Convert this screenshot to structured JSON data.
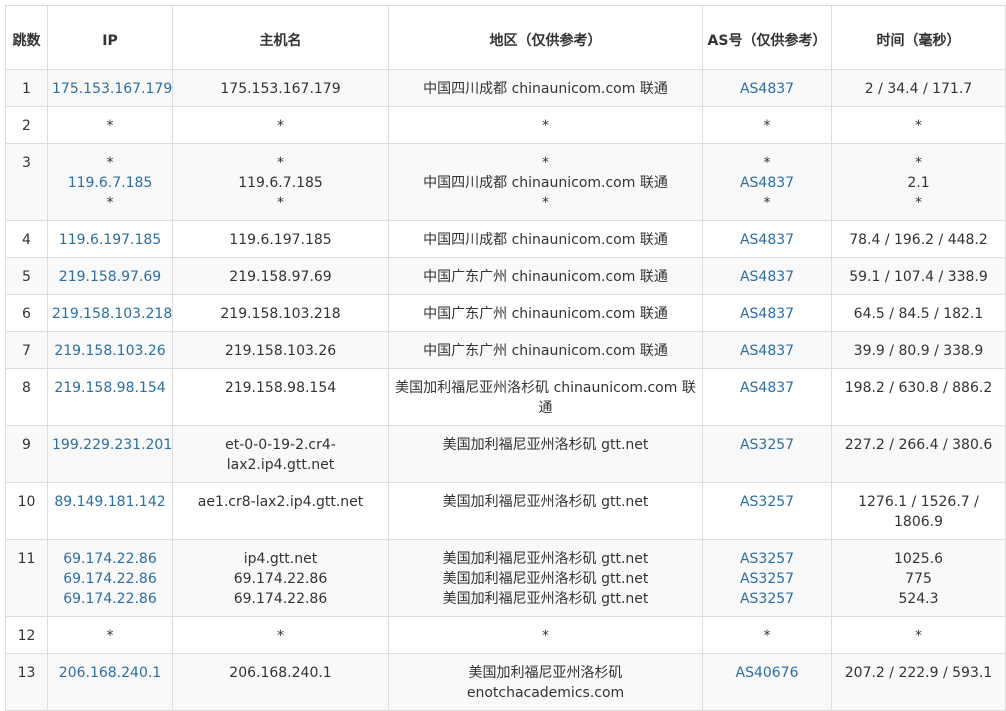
{
  "headers": {
    "hop": "跳数",
    "ip": "IP",
    "hostname": "主机名",
    "region": "地区（仅供参考）",
    "as": "AS号（仅供参考）",
    "time": "时间（毫秒）"
  },
  "rows": [
    {
      "hop": "1",
      "ip": [
        "175.153.167.179"
      ],
      "hostname": [
        "175.153.167.179"
      ],
      "region": [
        "中国四川成都 chinaunicom.com 联通"
      ],
      "as": [
        "AS4837"
      ],
      "time": [
        "2 / 34.4 / 171.7"
      ]
    },
    {
      "hop": "2",
      "ip": [
        "*"
      ],
      "hostname": [
        "*"
      ],
      "region": [
        "*"
      ],
      "as": [
        "*"
      ],
      "time": [
        "*"
      ]
    },
    {
      "hop": "3",
      "ip": [
        "*",
        "119.6.7.185",
        "*"
      ],
      "hostname": [
        "*",
        "119.6.7.185",
        "*"
      ],
      "region": [
        "*",
        "中国四川成都 chinaunicom.com 联通",
        "*"
      ],
      "as": [
        "*",
        "AS4837",
        "*"
      ],
      "time": [
        "*",
        "2.1",
        "*"
      ]
    },
    {
      "hop": "4",
      "ip": [
        "119.6.197.185"
      ],
      "hostname": [
        "119.6.197.185"
      ],
      "region": [
        "中国四川成都 chinaunicom.com 联通"
      ],
      "as": [
        "AS4837"
      ],
      "time": [
        "78.4 / 196.2 / 448.2"
      ]
    },
    {
      "hop": "5",
      "ip": [
        "219.158.97.69"
      ],
      "hostname": [
        "219.158.97.69"
      ],
      "region": [
        "中国广东广州 chinaunicom.com 联通"
      ],
      "as": [
        "AS4837"
      ],
      "time": [
        "59.1 / 107.4 / 338.9"
      ]
    },
    {
      "hop": "6",
      "ip": [
        "219.158.103.218"
      ],
      "hostname": [
        "219.158.103.218"
      ],
      "region": [
        "中国广东广州 chinaunicom.com 联通"
      ],
      "as": [
        "AS4837"
      ],
      "time": [
        "64.5 / 84.5 / 182.1"
      ]
    },
    {
      "hop": "7",
      "ip": [
        "219.158.103.26"
      ],
      "hostname": [
        "219.158.103.26"
      ],
      "region": [
        "中国广东广州 chinaunicom.com 联通"
      ],
      "as": [
        "AS4837"
      ],
      "time": [
        "39.9 / 80.9 / 338.9"
      ]
    },
    {
      "hop": "8",
      "ip": [
        "219.158.98.154"
      ],
      "hostname": [
        "219.158.98.154"
      ],
      "region": [
        "美国加利福尼亚州洛杉矶 chinaunicom.com 联通"
      ],
      "as": [
        "AS4837"
      ],
      "time": [
        "198.2 / 630.8 / 886.2"
      ]
    },
    {
      "hop": "9",
      "ip": [
        "199.229.231.201"
      ],
      "hostname": [
        "et-0-0-19-2.cr4-lax2.ip4.gtt.net"
      ],
      "region": [
        "美国加利福尼亚州洛杉矶 gtt.net"
      ],
      "as": [
        "AS3257"
      ],
      "time": [
        "227.2 / 266.4 / 380.6"
      ]
    },
    {
      "hop": "10",
      "ip": [
        "89.149.181.142"
      ],
      "hostname": [
        "ae1.cr8-lax2.ip4.gtt.net"
      ],
      "region": [
        "美国加利福尼亚州洛杉矶 gtt.net"
      ],
      "as": [
        "AS3257"
      ],
      "time": [
        "1276.1 / 1526.7 / 1806.9"
      ]
    },
    {
      "hop": "11",
      "ip": [
        "69.174.22.86",
        "69.174.22.86",
        "69.174.22.86"
      ],
      "hostname": [
        "ip4.gtt.net",
        "69.174.22.86",
        "69.174.22.86"
      ],
      "region": [
        "美国加利福尼亚州洛杉矶 gtt.net",
        "美国加利福尼亚州洛杉矶 gtt.net",
        "美国加利福尼亚州洛杉矶 gtt.net"
      ],
      "as": [
        "AS3257",
        "AS3257",
        "AS3257"
      ],
      "time": [
        "1025.6",
        "775",
        "524.3"
      ]
    },
    {
      "hop": "12",
      "ip": [
        "*"
      ],
      "hostname": [
        "*"
      ],
      "region": [
        "*"
      ],
      "as": [
        "*"
      ],
      "time": [
        "*"
      ]
    },
    {
      "hop": "13",
      "ip": [
        "206.168.240.1"
      ],
      "hostname": [
        "206.168.240.1"
      ],
      "region": [
        "美国加利福尼亚州洛杉矶 enotchacademics.com"
      ],
      "as": [
        "AS40676"
      ],
      "time": [
        "207.2 / 222.9 / 593.1"
      ]
    }
  ],
  "colors": {
    "link": "#2a6ea6",
    "text": "#333333",
    "border": "#dddddd",
    "stripe": "#f9f9f9"
  }
}
